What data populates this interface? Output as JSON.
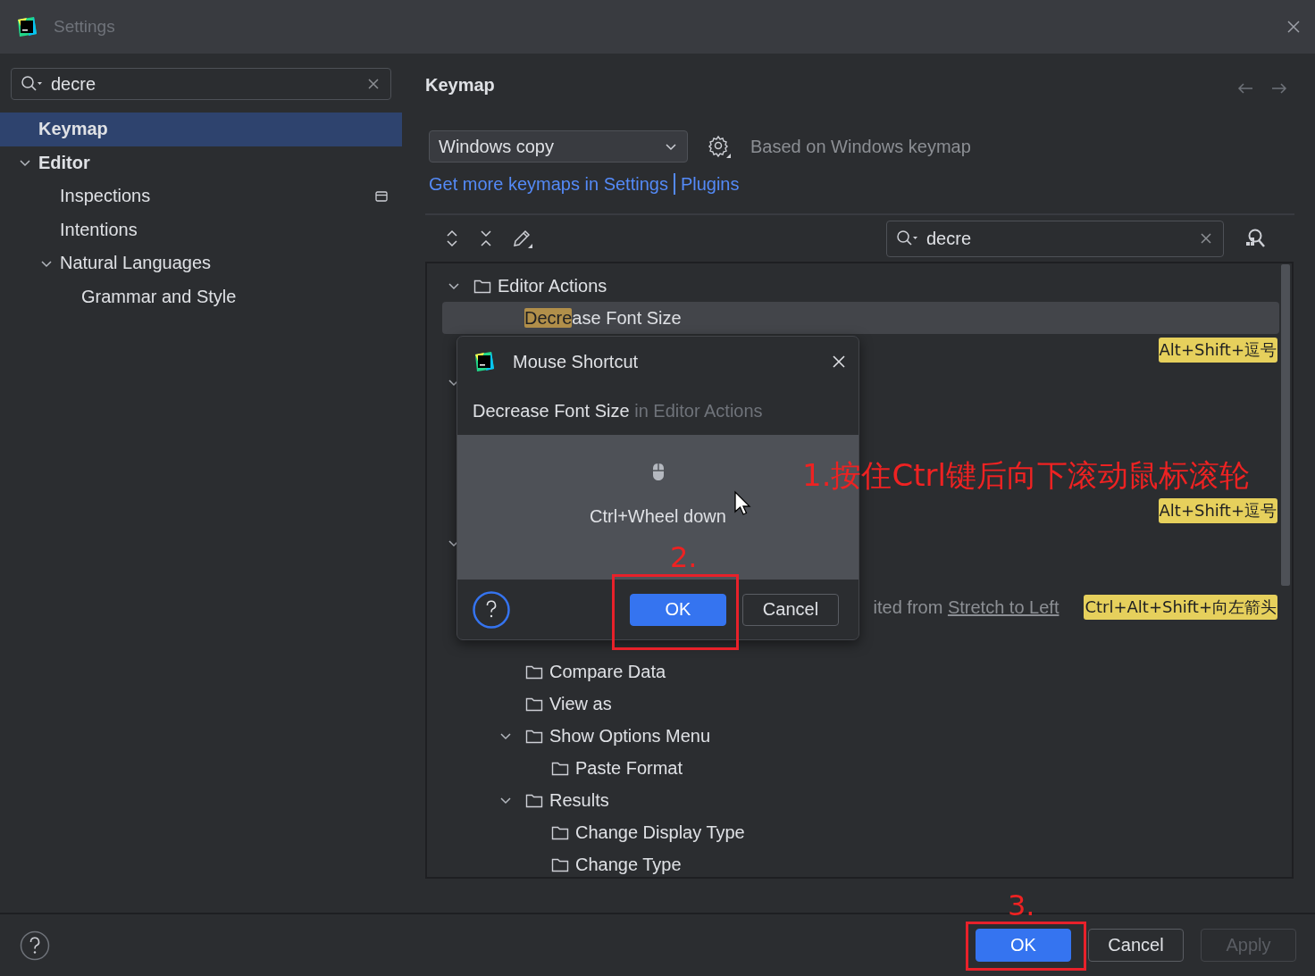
{
  "window": {
    "title": "Settings"
  },
  "sidebar": {
    "search": {
      "value": "decre"
    },
    "items": [
      {
        "label": "Keymap",
        "selected": true,
        "matched": true,
        "scope_icon": false
      },
      {
        "label": "Editor",
        "selected": false,
        "matched": true,
        "scope_icon": false,
        "expanded": true,
        "children": [
          {
            "label": "Inspections",
            "selected": false,
            "matched": false,
            "scope_icon": true
          },
          {
            "label": "Intentions",
            "selected": false,
            "matched": false,
            "scope_icon": false
          },
          {
            "label": "Natural Languages",
            "selected": false,
            "matched": false,
            "scope_icon": false,
            "expanded": true,
            "children": [
              {
                "label": "Grammar and Style",
                "selected": false,
                "matched": false,
                "scope_icon": false
              }
            ]
          }
        ]
      }
    ]
  },
  "page": {
    "title": "Keymap",
    "keymap_select": {
      "value": "Windows copy"
    },
    "based_on": "Based on Windows keymap",
    "links": [
      "Get more keymaps in Settings",
      "Plugins"
    ],
    "search": {
      "value": "decre"
    },
    "tree": [
      {
        "kind": "group",
        "label": "Editor Actions",
        "expanded": true,
        "children": [
          {
            "kind": "action",
            "match": "Decre",
            "rest": "ase Font Size",
            "selected": true
          },
          {
            "kind": "action",
            "shortcut": "Alt+Shift+逗号",
            "selected": false
          }
        ]
      },
      {
        "kind": "group",
        "expanded": true,
        "children": [
          {
            "kind": "covered"
          },
          {
            "kind": "covered"
          },
          {
            "kind": "covered"
          },
          {
            "kind": "action",
            "shortcut": "Alt+Shift+逗号",
            "selected": false
          }
        ]
      },
      {
        "kind": "group",
        "expanded": true,
        "children": [
          {
            "kind": "covered"
          },
          {
            "kind": "note",
            "text": "ited from ",
            "link": "Stretch to Left",
            "shortcut": "Ctrl+Alt+Shift+向左箭头"
          },
          {
            "kind": "covered",
            "expanded": true,
            "children": [
              {
                "kind": "group",
                "label": "Compare Data"
              },
              {
                "kind": "group",
                "label": "View as"
              },
              {
                "kind": "group",
                "label": "Show Options Menu",
                "expanded": true,
                "children": [
                  {
                    "kind": "group",
                    "label": "Paste Format"
                  }
                ]
              },
              {
                "kind": "group",
                "label": "Results",
                "expanded": true,
                "children": [
                  {
                    "kind": "group",
                    "label": "Change Display Type"
                  },
                  {
                    "kind": "group",
                    "label": "Change Type"
                  }
                ]
              }
            ]
          }
        ]
      }
    ]
  },
  "dialog": {
    "title": "Mouse Shortcut",
    "action": "Decrease Font Size",
    "context": " in Editor Actions",
    "shortcut": "Ctrl+Wheel down",
    "buttons": [
      {
        "label": "OK",
        "primary": true
      },
      {
        "label": "Cancel",
        "primary": false
      }
    ]
  },
  "buttons": [
    {
      "label": "OK",
      "primary": true,
      "disabled": false
    },
    {
      "label": "Cancel",
      "primary": false,
      "disabled": false
    },
    {
      "label": "Apply",
      "primary": false,
      "disabled": true
    }
  ],
  "annotations": [
    {
      "text": "1.按住Ctrl键后向下滚动鼠标滚轮"
    },
    {
      "text": "2."
    },
    {
      "text": "3."
    }
  ]
}
